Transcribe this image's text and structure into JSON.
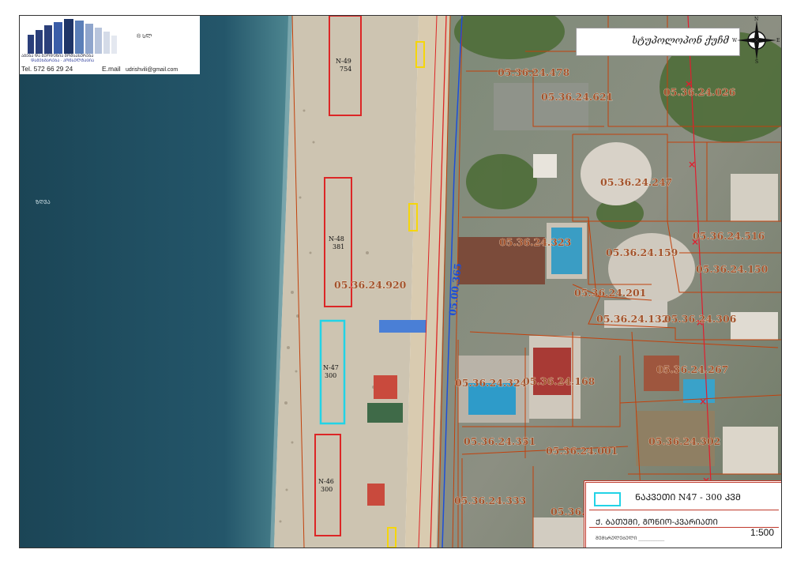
{
  "header": {
    "company_line1": "ᲐᲒᲔᲑᲐ ᲓᲐ ᲒᲔᲝᲓᲔᲖᲘᲐ ᲛᲝᲛᲡᲐᲮᲣᲠᲔᲑᲐ",
    "company_line2": "ᲓᲐᲛᲔᲮᲛᲐᲠᲔᲑᲐ · ᲙᲝᲜᲡᲣᲚᲢᲐᲪᲘᲐ",
    "logo_mark": "® ᲡᲚ",
    "tel": "Tel.   572 66 29 24",
    "email_label": "E.mail",
    "email": "udrishvili@gmail.com"
  },
  "north_box": {
    "signature": "სტუპოლოპონ ქუჩმ",
    "compass": {
      "n": "N",
      "s": "S",
      "e": "E",
      "w": "W"
    }
  },
  "water_label": "ᲖᲦᲕᲐ",
  "road_label": "05.00.365",
  "plots": [
    {
      "code": "N-49",
      "area": "754"
    },
    {
      "code": "N-48",
      "area": "381"
    },
    {
      "code": "N-47",
      "area": "300"
    },
    {
      "code": "N-46",
      "area": "300"
    }
  ],
  "parcels": [
    "05.36.24.478",
    "05.36.24.621",
    "05.36.24.026",
    "05.36.24.247",
    "05.36.24.516",
    "05.36.24.323",
    "05.36.24.159",
    "05.36.24.150",
    "05.36.24.920",
    "05.36.24.201",
    "05.36.24.132",
    "05.36.24.306",
    "05.36.24.267",
    "05.36.24.324",
    "05.36.24.168",
    "05.36.24.351",
    "05.36.24.001",
    "05.36.24.302",
    "05.36.24.333",
    "05.36.2"
  ],
  "legend": {
    "title": "ᲜᲐᲙᲕᲔᲗᲘ  N47  -  300  ᲙᲕᲛ",
    "address": "Ქ. ᲑᲐᲗᲣᲛᲘ, ᲒᲝᲜᲘᲝ-ᲙᲕᲐᲠᲘᲐᲗᲘ",
    "scale": "1:500",
    "note": "ᲨᲔᲛᲡᲠᲣᲚᲔᲑᲔᲚᲘ ___________",
    "swatch_color": "#22d3e6"
  },
  "colors": {
    "sea": "#1f4a5c",
    "beach": "#cfc6b4",
    "parcel_line": "#c2410c",
    "plot_red": "#dc2626",
    "plot_cyan": "#22d3e6",
    "road_blue": "#1d4ed8",
    "label": "#a0522d"
  }
}
